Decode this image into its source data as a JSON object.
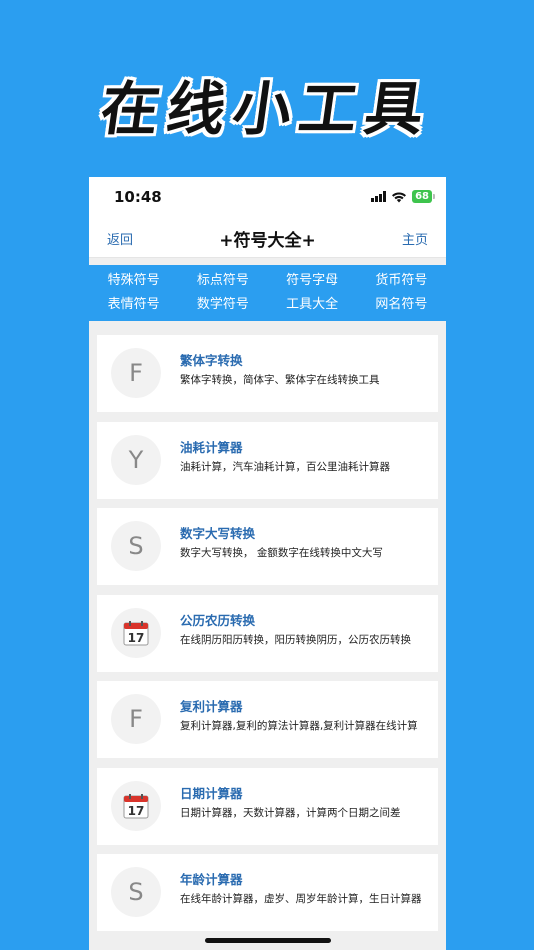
{
  "promo": {
    "title": "在线小工具"
  },
  "status": {
    "time": "10:48",
    "battery": "68"
  },
  "nav": {
    "back": "返回",
    "title": "+符号大全+",
    "home": "主页"
  },
  "categories": [
    {
      "label": "特殊符号"
    },
    {
      "label": "标点符号"
    },
    {
      "label": "符号字母"
    },
    {
      "label": "货币符号"
    },
    {
      "label": "表情符号"
    },
    {
      "label": "数学符号"
    },
    {
      "label": "工具大全"
    },
    {
      "label": "网名符号"
    }
  ],
  "tools": [
    {
      "avatar": "F",
      "icon": "letter",
      "title": "繁体字转换",
      "desc": "繁体字转换，简体字、繁体字在线转换工具"
    },
    {
      "avatar": "Y",
      "icon": "letter",
      "title": "油耗计算器",
      "desc": "油耗计算，汽车油耗计算，百公里油耗计算器"
    },
    {
      "avatar": "S",
      "icon": "letter",
      "title": "数字大写转换",
      "desc": "数字大写转换， 金额数字在线转换中文大写"
    },
    {
      "avatar": "17",
      "icon": "calendar-icon",
      "title": "公历农历转换",
      "desc": "在线阴历阳历转换，阳历转换阴历，公历农历转换"
    },
    {
      "avatar": "F",
      "icon": "letter",
      "title": "复利计算器",
      "desc": "复利计算器,复利的算法计算器,复利计算器在线计算"
    },
    {
      "avatar": "17",
      "icon": "calendar-icon",
      "title": "日期计算器",
      "desc": "日期计算器，天数计算器，计算两个日期之间差"
    },
    {
      "avatar": "S",
      "icon": "letter",
      "title": "年龄计算器",
      "desc": "在线年龄计算器，虚岁、周岁年龄计算，生日计算器"
    }
  ],
  "colors": {
    "background": "#2b9ef0",
    "accent": "#2a6bb0",
    "battery": "#3ec44d"
  }
}
